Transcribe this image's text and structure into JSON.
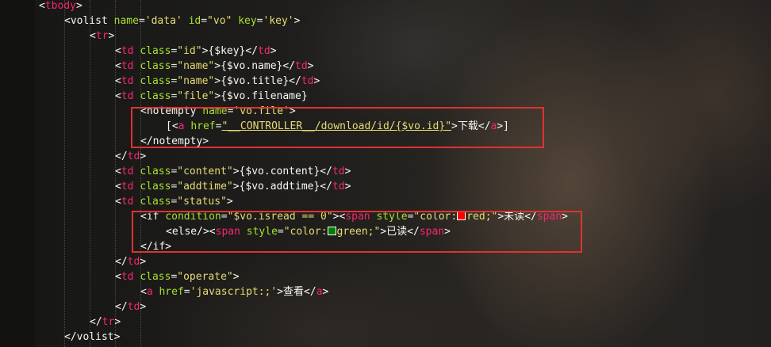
{
  "editor": {
    "colors": {
      "tag": "#f8f8f2",
      "html_tag": "#f92672",
      "attribute": "#a6e22e",
      "string": "#e6db74",
      "highlight_box": "#e0322f",
      "swatch_red": "#ff0000",
      "swatch_green": "#008000"
    },
    "lines": {
      "l1": {
        "open": "<",
        "name": "tbody",
        "close": ">"
      },
      "l2": {
        "open": "<",
        "name": "volist",
        "a1": "name",
        "v1": "'data'",
        "a2": "id",
        "v2": "\"vo\"",
        "a3": "key",
        "v3": "'key'",
        "close": ">"
      },
      "l3": {
        "open": "<",
        "name": "tr",
        "close": ">"
      },
      "l4": {
        "open": "<",
        "name": "td",
        "a1": "class",
        "v1": "\"id\"",
        "mid": ">{$key}</",
        "name2": "td",
        "close": ">"
      },
      "l5": {
        "open": "<",
        "name": "td",
        "a1": "class",
        "v1": "\"name\"",
        "mid": ">{$vo.name}</",
        "name2": "td",
        "close": ">"
      },
      "l6": {
        "open": "<",
        "name": "td",
        "a1": "class",
        "v1": "\"name\"",
        "mid": ">{$vo.title}</",
        "name2": "td",
        "close": ">"
      },
      "l7": {
        "open": "<",
        "name": "td",
        "a1": "class",
        "v1": "\"file\"",
        "mid": ">{$vo.filename}"
      },
      "l8": {
        "open": "<notempty ",
        "a1": "name",
        "v1": "'vo.file'",
        "close": ">"
      },
      "l9": {
        "pre": "[<",
        "name": "a",
        "a1": "href",
        "v1": "\"__CONTROLLER__/download/id/{$vo.id}\"",
        "mid": ">下载</",
        "name2": "a",
        "close": ">]"
      },
      "l10": {
        "text": "</notempty>"
      },
      "l11": {
        "open": "</",
        "name": "td",
        "close": ">"
      },
      "l12": {
        "open": "<",
        "name": "td",
        "a1": "class",
        "v1": "\"content\"",
        "mid": ">{$vo.content}</",
        "name2": "td",
        "close": ">"
      },
      "l13": {
        "open": "<",
        "name": "td",
        "a1": "class",
        "v1": "\"addtime\"",
        "mid": ">{$vo.addtime}</",
        "name2": "td",
        "close": ">"
      },
      "l14": {
        "open": "<",
        "name": "td",
        "a1": "class",
        "v1": "\"status\"",
        "close": ">"
      },
      "l15": {
        "open": "<if ",
        "a1": "condition",
        "v1": "\"$vo.isread == 0\"",
        "mid": "><",
        "name": "span",
        "a2": "style",
        "v2a": "\"color:",
        "v2b": "red;\"",
        "mid2": ">未读</",
        "name2": "span",
        "close": ">"
      },
      "l16": {
        "open": "<else/><",
        "name": "span",
        "a1": "style",
        "v1a": "\"color:",
        "v1b": "green;\"",
        "mid": ">已读</",
        "name2": "span",
        "close": ">"
      },
      "l17": {
        "text": "</if>"
      },
      "l18": {
        "open": "</",
        "name": "td",
        "close": ">"
      },
      "l19": {
        "open": "<",
        "name": "td",
        "a1": "class",
        "v1": "\"operate\"",
        "close": ">"
      },
      "l20": {
        "open": "<",
        "name": "a",
        "a1": "href",
        "v1": "'javascript:;'",
        "mid": ">查看</",
        "name2": "a",
        "close": ">"
      },
      "l21": {
        "open": "</",
        "name": "td",
        "close": ">"
      },
      "l22": {
        "open": "</",
        "name": "tr",
        "close": ">"
      },
      "l23": {
        "text": "</volist>"
      }
    }
  }
}
